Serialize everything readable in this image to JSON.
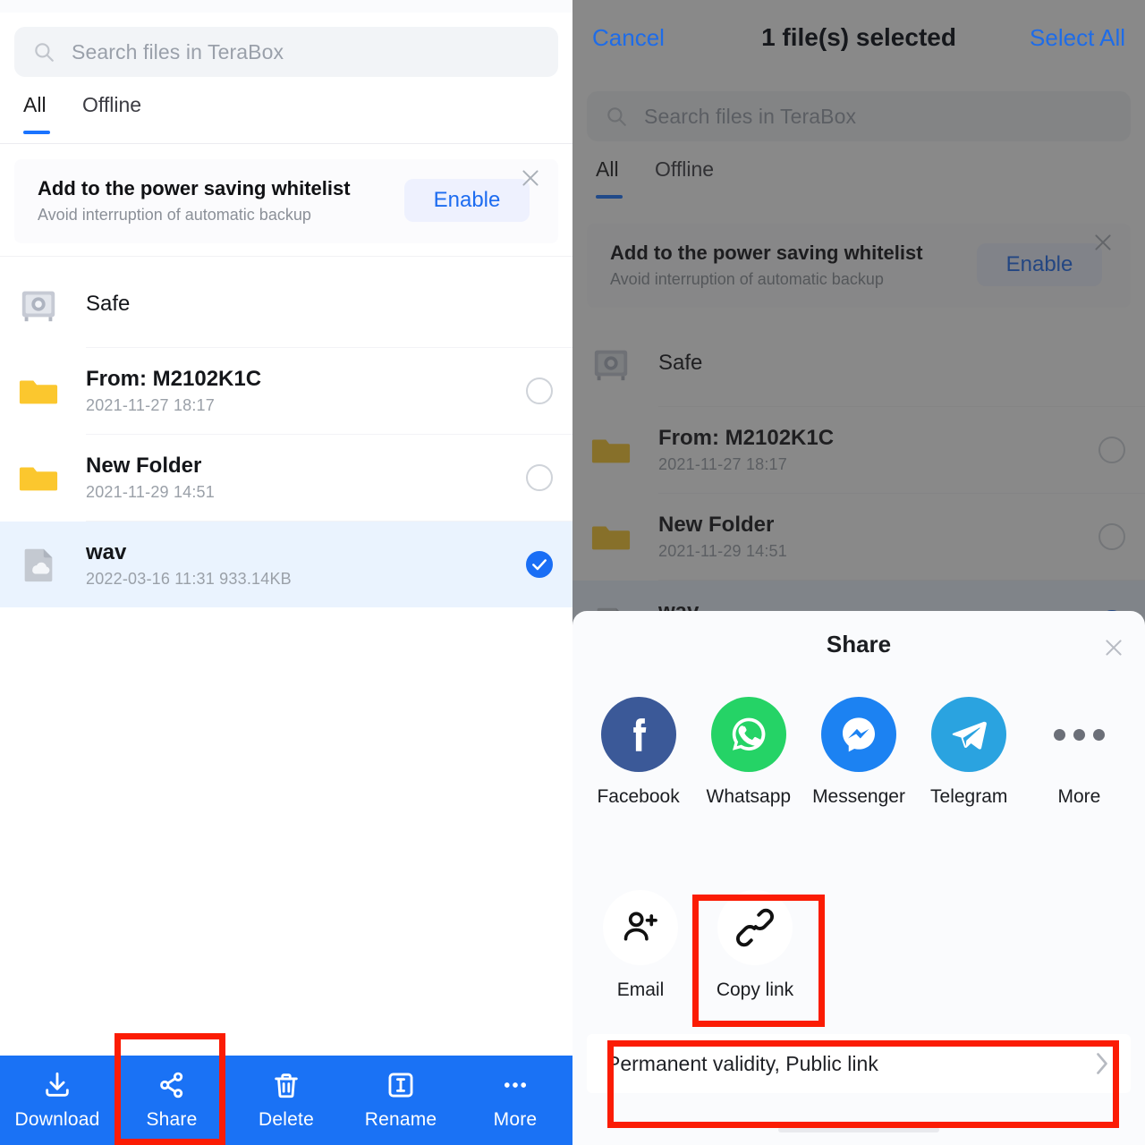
{
  "app": {
    "name": "TeraBox"
  },
  "search": {
    "placeholder": "Search files in TeraBox",
    "icon": "search-icon"
  },
  "tabs": [
    {
      "label": "All",
      "active": true
    },
    {
      "label": "Offline",
      "active": false
    }
  ],
  "banner": {
    "title": "Add to the power saving whitelist",
    "subtitle": "Avoid interruption of automatic backup",
    "button_label": "Enable",
    "close_icon": "close-icon"
  },
  "files": [
    {
      "name": "Safe",
      "meta": "",
      "icon": "safe-icon",
      "checkbox": "none",
      "selected": false
    },
    {
      "name": "From: M2102K1C",
      "meta": "2021-11-27  18:17",
      "icon": "folder-icon",
      "checkbox": "empty",
      "selected": false
    },
    {
      "name": "New Folder",
      "meta": "2021-11-29  14:51",
      "icon": "folder-icon",
      "checkbox": "empty",
      "selected": false
    },
    {
      "name": "wav",
      "meta": "2022-03-16  11:31  933.14KB",
      "icon": "cloud-file-icon",
      "checkbox": "checked",
      "selected": true
    }
  ],
  "action_bar": [
    {
      "label": "Download",
      "icon": "download-icon",
      "highlighted": false
    },
    {
      "label": "Share",
      "icon": "share-nodes-icon",
      "highlighted": true
    },
    {
      "label": "Delete",
      "icon": "trash-icon",
      "highlighted": false
    },
    {
      "label": "Rename",
      "icon": "rename-icon",
      "highlighted": false
    },
    {
      "label": "More",
      "icon": "ellipsis-icon",
      "highlighted": false
    }
  ],
  "selection_header": {
    "cancel_label": "Cancel",
    "title": "1 file(s) selected",
    "select_all_label": "Select All"
  },
  "share_sheet": {
    "title": "Share",
    "close_icon": "close-icon",
    "apps": [
      {
        "label": "Facebook",
        "icon": "facebook-icon",
        "color": "#3b5998"
      },
      {
        "label": "Whatsapp",
        "icon": "whatsapp-icon",
        "color": "#25d366"
      },
      {
        "label": "Messenger",
        "icon": "messenger-icon",
        "color": "#1c82f2"
      },
      {
        "label": "Telegram",
        "icon": "telegram-icon",
        "color": "#2aa3e0"
      },
      {
        "label": "More",
        "icon": "ellipsis-icon",
        "color": "#6b6f78"
      }
    ],
    "options": [
      {
        "label": "Email",
        "icon": "person-add-icon",
        "highlighted": false
      },
      {
        "label": "Copy link",
        "icon": "link-icon",
        "highlighted": true
      }
    ],
    "validity": {
      "label": "Permanent validity, Public link",
      "chevron_icon": "chevron-right-icon"
    }
  },
  "colors": {
    "brand_blue": "#1a72f5",
    "link_blue": "#1e6ce8",
    "highlight_red": "#fb1c04",
    "selected_row": "#eaf3fe",
    "folder_yellow": "#fbc72e"
  }
}
